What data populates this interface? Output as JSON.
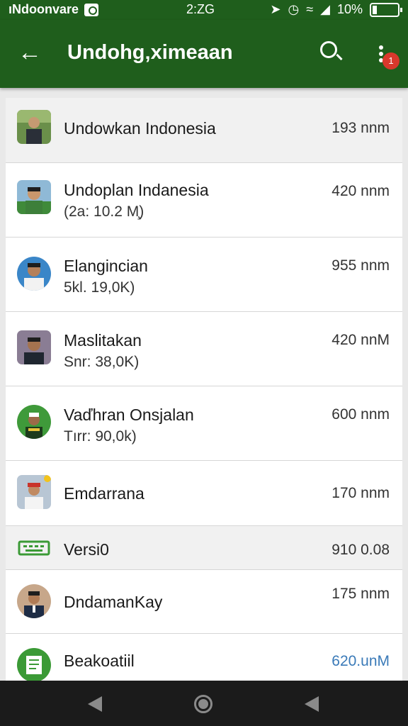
{
  "status_bar": {
    "carrier": "ıNdoonvare",
    "time": "2:ZG",
    "battery": "10%"
  },
  "app_bar": {
    "title": "Undohg‚ximeaan",
    "notification_count": "1"
  },
  "items": [
    {
      "title": "Undowkan Indonesia",
      "subtitle": "",
      "value": "193 nnm",
      "avatar": "person-forest"
    },
    {
      "title": "Undoplan Indanesia",
      "subtitle": "(2a: 10.2 M̧)",
      "value": "420 nnm",
      "avatar": "person-green"
    },
    {
      "title": "Elangincian",
      "subtitle": "5kl. 19,0K)",
      "value": "955 nnm",
      "avatar": "person-blue"
    },
    {
      "title": "Maslitakan",
      "subtitle": "Snr: 38,0K)",
      "value": "420 nnM",
      "avatar": "person-dark"
    },
    {
      "title": "Vaďhran Onsjalan",
      "subtitle": "Tırr: 90,0k)",
      "value": "600 nnm",
      "avatar": "person-circle"
    },
    {
      "title": "Emdarrana",
      "subtitle": "",
      "value": "170 nnm",
      "avatar": "person-red"
    },
    {
      "title": "Versi0",
      "subtitle": "",
      "value": "910 0.08",
      "avatar": "keyboard-icon"
    },
    {
      "title": "DndamanKay",
      "subtitle": "",
      "value": "175 nnm",
      "avatar": "person-suit"
    },
    {
      "title": "Beakoatiil",
      "subtitle": "",
      "value": "620.unM",
      "avatar": "document-icon"
    }
  ],
  "colors": {
    "app_bar": "#1f5e1c",
    "badge": "#d9382c",
    "link_value": "#3a7ab8"
  }
}
